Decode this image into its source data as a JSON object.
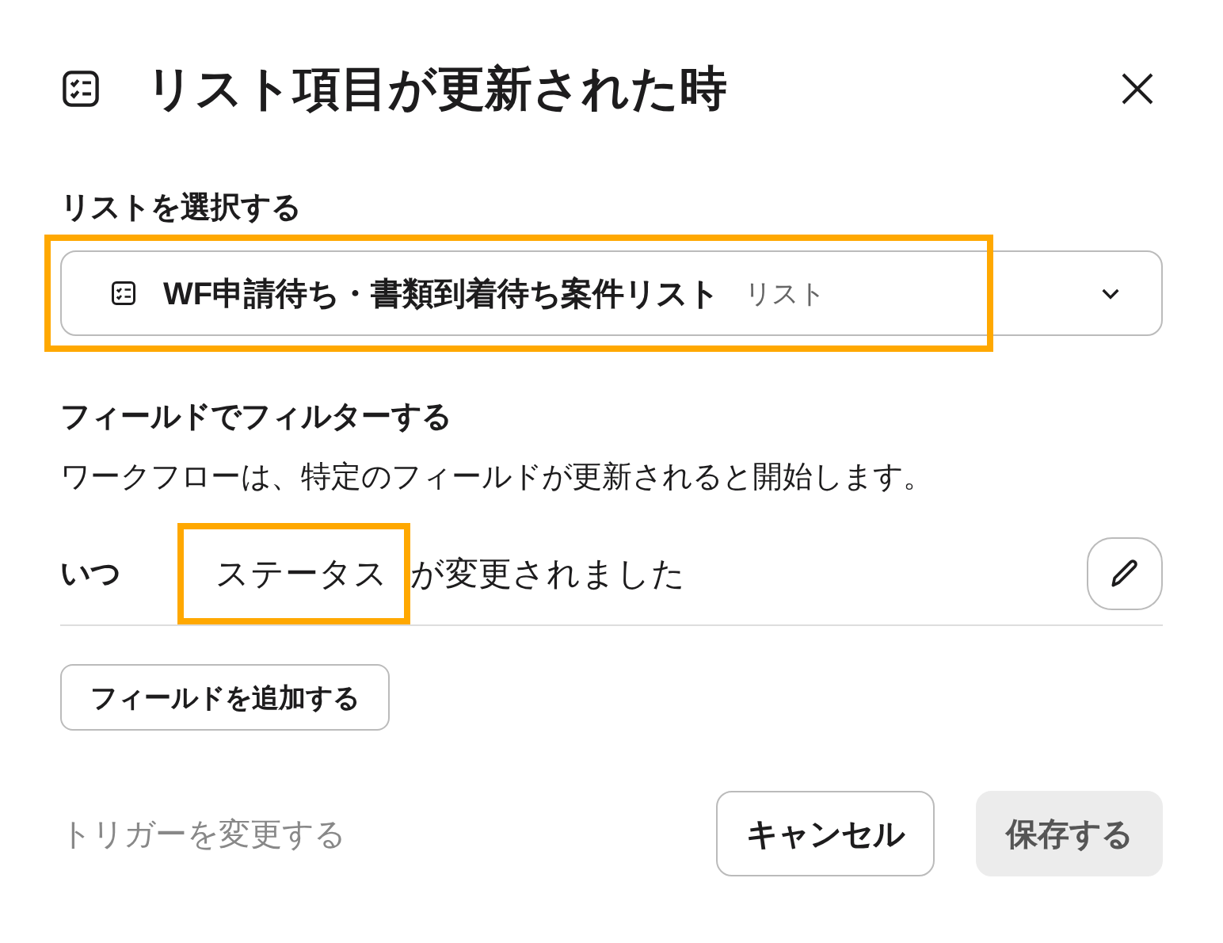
{
  "dialog": {
    "title": "リスト項目が更新された時"
  },
  "list_select": {
    "label": "リストを選択する",
    "value": "WF申請待ち・書類到着待ち案件リスト",
    "hint": "リスト",
    "highlighted": true
  },
  "filter": {
    "heading": "フィールドでフィルターする",
    "description": "ワークフローは、特定のフィールドが更新されると開始します。",
    "condition": {
      "prefix": "いつ",
      "field": "ステータス",
      "suffix": "が変更されました",
      "highlighted": true
    },
    "add_button": "フィールドを追加する"
  },
  "footer": {
    "change_trigger": "トリガーを変更する",
    "cancel": "キャンセル",
    "save": {
      "label": "保存する",
      "disabled": true
    }
  }
}
